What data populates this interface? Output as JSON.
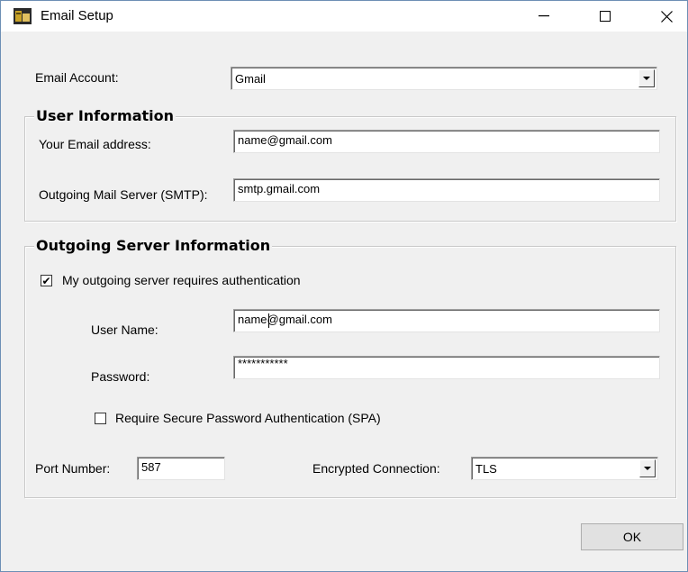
{
  "window": {
    "title": "Email Setup",
    "minimize_glyph": "—",
    "close_glyph": "✕",
    "icon": "app-icon"
  },
  "email_account": {
    "label": "Email Account:",
    "value": "Gmail"
  },
  "user_info": {
    "title": "User Information",
    "email_label": "Your Email address:",
    "email_value": "name@gmail.com",
    "smtp_label": "Outgoing Mail Server (SMTP):",
    "smtp_value": "smtp.gmail.com"
  },
  "outgoing": {
    "title": "Outgoing Server Information",
    "auth_checkbox_label": "My outgoing server requires authentication",
    "auth_checked": true,
    "username_label": "User Name:",
    "username_value": "name@gmail.com",
    "password_label": "Password:",
    "password_value": "***********",
    "spa_checkbox_label": "Require Secure Password Authentication (SPA)",
    "spa_checked": false,
    "port_label": "Port Number:",
    "port_value": "587",
    "encryption_label": "Encrypted Connection:",
    "encryption_value": "TLS"
  },
  "ok_button_label": "OK"
}
